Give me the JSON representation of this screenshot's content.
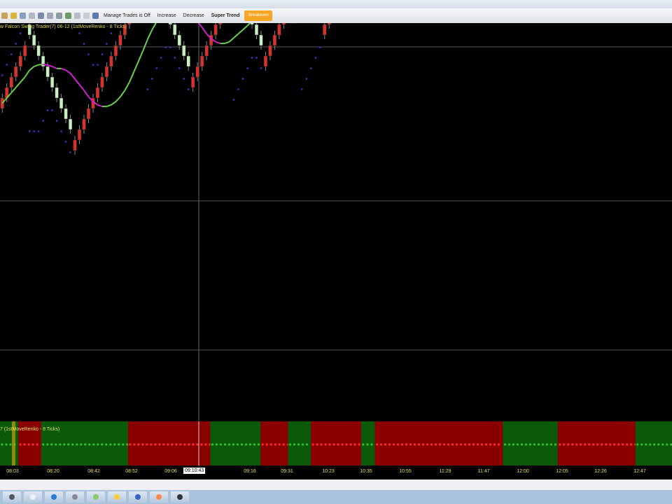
{
  "toolbar": {
    "manage_trades": "Manage Trades is Off",
    "increase": "Increase",
    "decrease": "Decrease",
    "super_trend": "Super Trend",
    "orange_button": "Breakeven"
  },
  "chart": {
    "title": "w Falcon Swing Trader(7) 06-12 (1stMoveRenko - 8 Ticks)",
    "indicator_title": "7 (1stMoveRenko - 8 Ticks)",
    "cursor_time": "09:10:43"
  },
  "colors": {
    "up": "#c8f0c0",
    "down": "#d8322a",
    "ma_up": "#6ad04a",
    "ma_down": "#d020d0",
    "supertrend": "#3a3ad8",
    "ind_up": "#0a5a0a",
    "ind_down": "#8a0000"
  },
  "chart_data": {
    "type": "renko",
    "brick_size_ticks": 8,
    "swings_bricks": [
      -6,
      10,
      -16,
      10,
      -9,
      7,
      -8,
      5,
      -12,
      4,
      -12,
      13,
      -11,
      4,
      -7,
      9,
      -5
    ],
    "trend_states": [
      {
        "state": "up",
        "bricks": 4
      },
      {
        "state": "down",
        "bricks": 5
      },
      {
        "state": "up",
        "bricks": 19
      },
      {
        "state": "down",
        "bricks": 18
      },
      {
        "state": "up",
        "bricks": 11
      },
      {
        "state": "down",
        "bricks": 6
      },
      {
        "state": "up",
        "bricks": 5
      },
      {
        "state": "down",
        "bricks": 11
      },
      {
        "state": "up",
        "bricks": 3
      },
      {
        "state": "down",
        "bricks": 28
      },
      {
        "state": "up",
        "bricks": 12
      },
      {
        "state": "down",
        "bricks": 17
      },
      {
        "state": "up",
        "bricks": 8
      }
    ],
    "time_labels": [
      "08:03",
      "08:20",
      "08:42",
      "08:52",
      "09:06",
      "09:16",
      "09:31",
      "10:23",
      "10:35",
      "10:55",
      "11:29",
      "11:47",
      "12:00",
      "12:05",
      "12:26",
      "12:47"
    ]
  }
}
